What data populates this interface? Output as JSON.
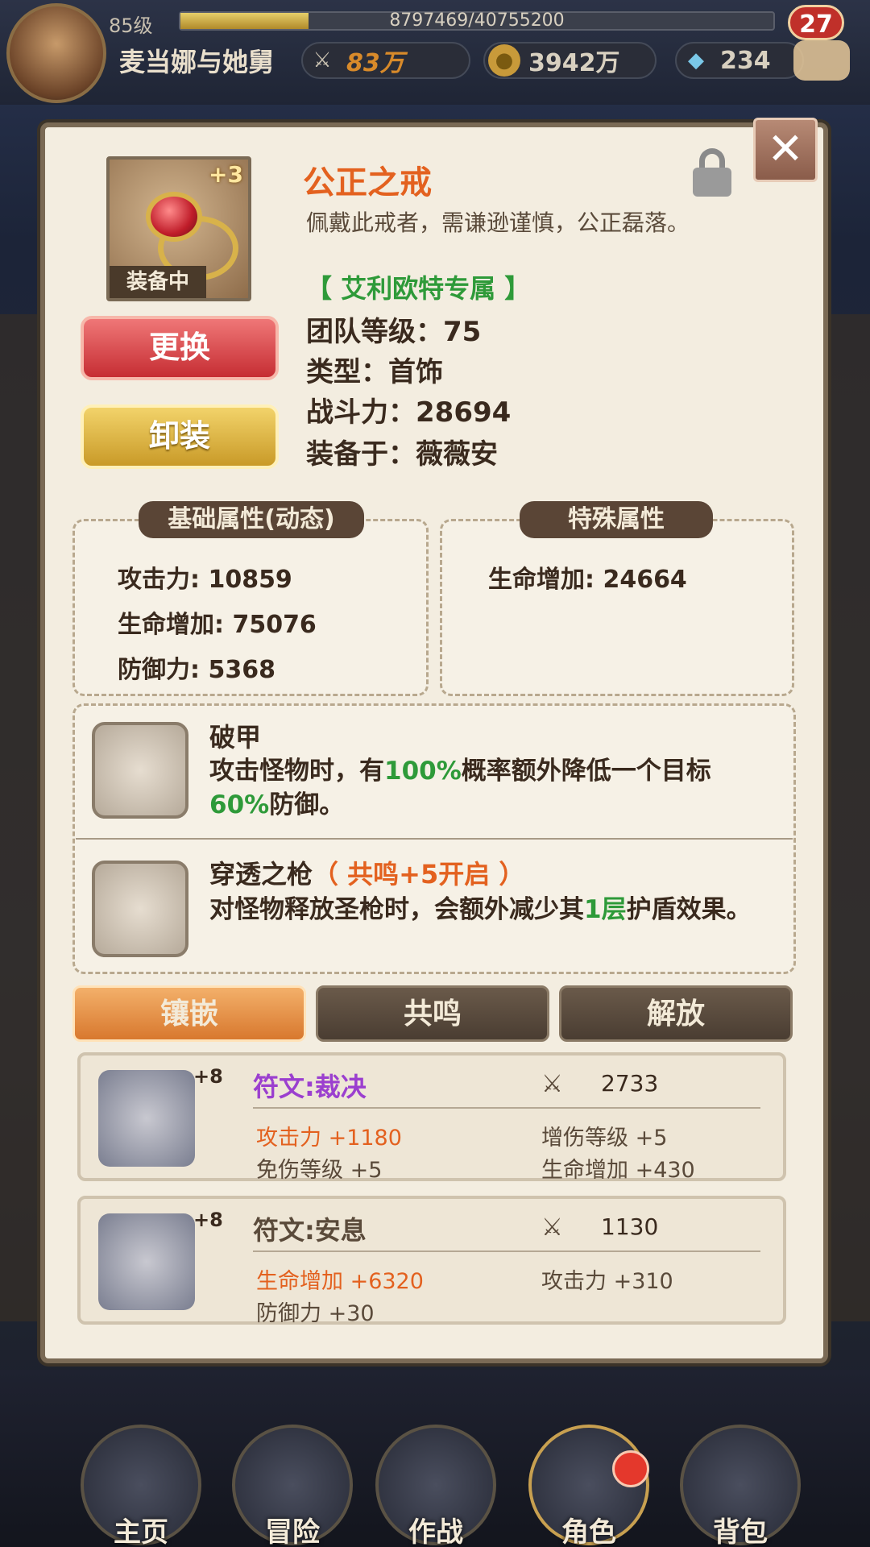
{
  "topbar": {
    "level": "85级",
    "exp_text": "8797469/40755200",
    "exp_fraction": 0.216,
    "player_name": "麦当娜与她舅",
    "combat_power": "83万",
    "gold": "3942万",
    "gems": "234",
    "notification_count": "27"
  },
  "item": {
    "plus_level": "+3",
    "equipped_label": "装备中",
    "name": "公正之戒",
    "description": "佩戴此戒者，需谦逊谨慎，公正磊落。",
    "exclusive": "【 艾利欧特专属 】",
    "team_level": "团队等级：75",
    "type": "类型：首饰",
    "power": "战斗力：28694",
    "equipped_on": "装备于：薇薇安"
  },
  "buttons": {
    "replace": "更换",
    "unequip": "卸装",
    "close": "✕"
  },
  "base_attrs": {
    "title": "基础属性(动态)",
    "lines": [
      "攻击力: 10859",
      "生命增加: 75076",
      "防御力: 5368"
    ]
  },
  "special_attrs": {
    "title": "特殊属性",
    "lines": [
      "生命增加: 24664"
    ]
  },
  "skills": [
    {
      "name": "破甲",
      "desc_a": "攻击怪物时，有",
      "desc_hl1": "100%",
      "desc_b": "概率额外降低一个目标",
      "desc_hl2": "60%",
      "desc_c": "防御。"
    },
    {
      "name": "穿透之枪",
      "tag": "（ 共鸣+5开启 ）",
      "desc_a": "对怪物释放圣枪时，会额外减少其",
      "desc_hl1": "1层",
      "desc_b": "护盾效果。"
    }
  ],
  "tabs": [
    "镶嵌",
    "共鸣",
    "解放"
  ],
  "runes": [
    {
      "plus": "+8",
      "name": "符文:裁决",
      "power": "2733",
      "stats_left": [
        "攻击力 +1180",
        "免伤等级 +5"
      ],
      "stats_right": [
        "增伤等级 +5",
        "生命增加 +430"
      ]
    },
    {
      "plus": "+8",
      "name": "符文:安息",
      "power": "1130",
      "stats_left": [
        "生命增加 +6320",
        "防御力 +30"
      ],
      "stats_right": [
        "攻击力 +310"
      ]
    }
  ],
  "nav": [
    "主页",
    "冒险",
    "作战",
    "角色",
    "背包"
  ],
  "colors": {
    "accent_orange": "#e3611f",
    "green": "#2e9a39",
    "purple": "#9b3fcf"
  }
}
